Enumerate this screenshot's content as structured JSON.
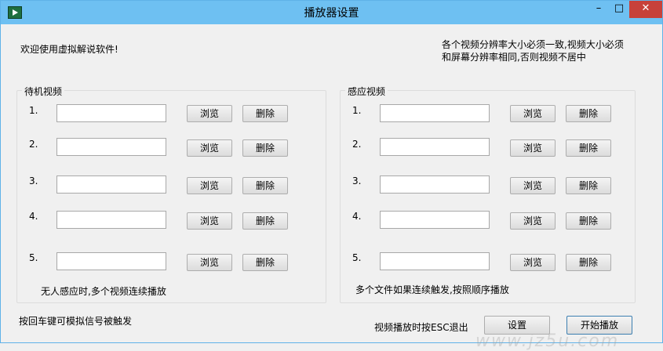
{
  "window": {
    "title": "播放器设置",
    "minimize": "–",
    "maximize": "□",
    "close": "✕"
  },
  "intro": "欢迎使用虚拟解说软件!",
  "notice_line1": "各个视频分辨率大小必须一致,视频大小必须",
  "notice_line2": "和屏幕分辨率相同,否则视频不居中",
  "idle_group": {
    "title": "待机视频",
    "rows": [
      {
        "num": "1.",
        "value": "",
        "browse": "浏览",
        "delete": "删除"
      },
      {
        "num": "2.",
        "value": "",
        "browse": "浏览",
        "delete": "删除"
      },
      {
        "num": "3.",
        "value": "",
        "browse": "浏览",
        "delete": "删除"
      },
      {
        "num": "4.",
        "value": "",
        "browse": "浏览",
        "delete": "删除"
      },
      {
        "num": "5.",
        "value": "",
        "browse": "浏览",
        "delete": "删除"
      }
    ],
    "note": "无人感应时,多个视频连续播放"
  },
  "sensor_group": {
    "title": "感应视频",
    "rows": [
      {
        "num": "1.",
        "value": "",
        "browse": "浏览",
        "delete": "删除"
      },
      {
        "num": "2.",
        "value": "",
        "browse": "浏览",
        "delete": "删除"
      },
      {
        "num": "3.",
        "value": "",
        "browse": "浏览",
        "delete": "删除"
      },
      {
        "num": "4.",
        "value": "",
        "browse": "浏览",
        "delete": "删除"
      },
      {
        "num": "5.",
        "value": "",
        "browse": "浏览",
        "delete": "删除"
      }
    ],
    "note": "多个文件如果连续触发,按照顺序播放"
  },
  "footer": {
    "enter_hint": "按回车键可模拟信号被触发",
    "esc_hint": "视频播放时按ESC退出",
    "settings_button": "设置",
    "start_button": "开始播放"
  },
  "watermark": "www.jz5u.com",
  "colors": {
    "titlebar": "#6ec0f2",
    "close": "#c7413a",
    "background": "#f0f0f0"
  }
}
